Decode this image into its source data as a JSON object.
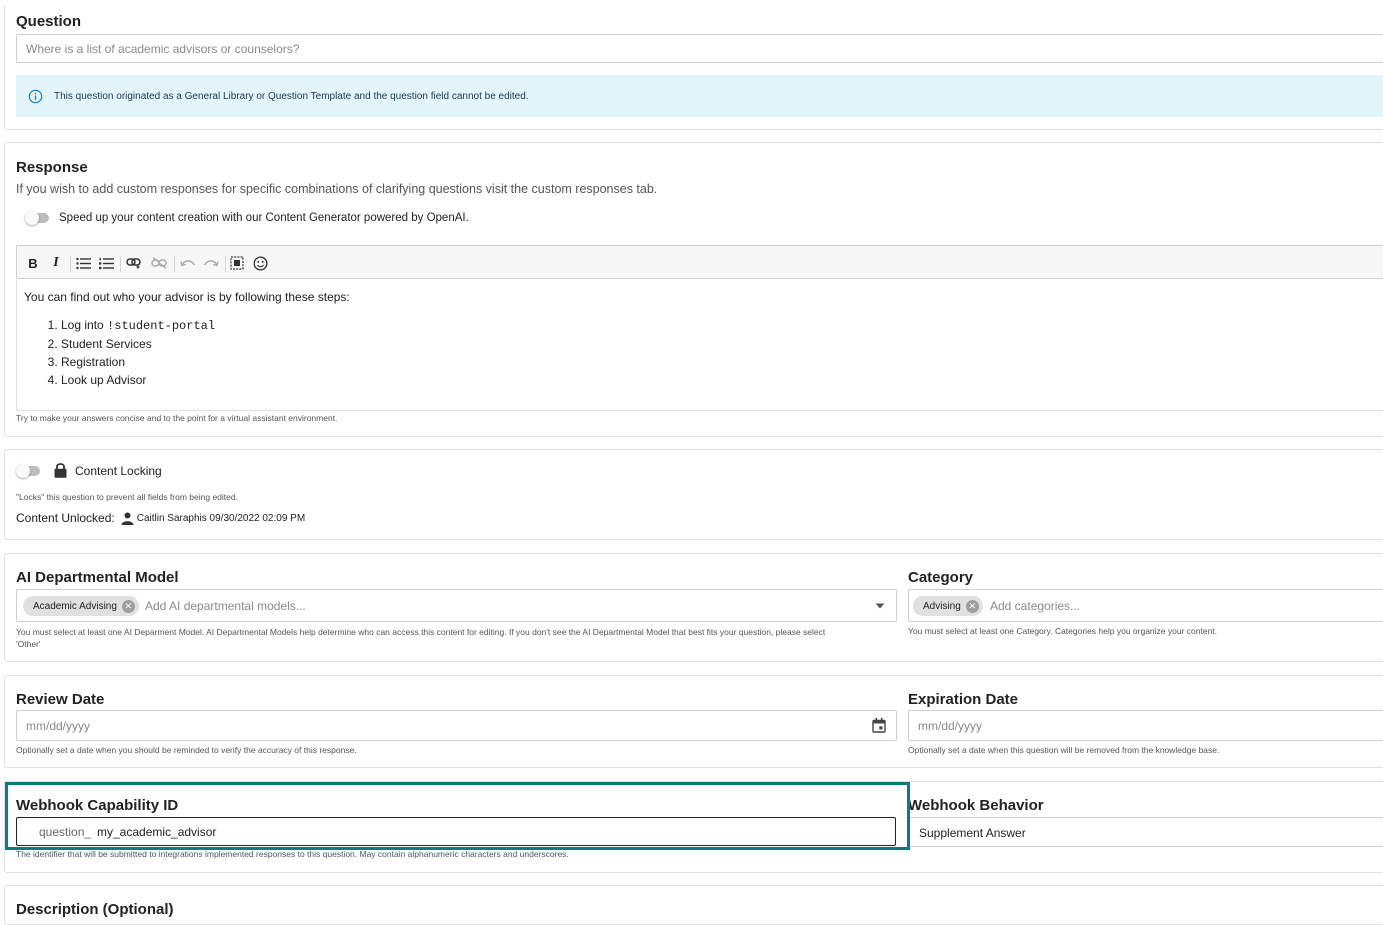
{
  "question": {
    "heading": "Question",
    "placeholder": "Where is a list of academic advisors or counselors?",
    "info_text": "This question originated as a General Library or Question Template and the question field cannot be edited."
  },
  "response": {
    "heading": "Response",
    "subtitle": "If you wish to add custom responses for specific combinations of clarifying questions visit the custom responses tab.",
    "generator_label": "Speed up your content creation with our Content Generator powered by OpenAI.",
    "toolbar": {
      "icons": [
        "bold-icon",
        "italic-icon",
        "bullet-list-icon",
        "numbered-list-icon",
        "insert-link-icon",
        "remove-link-icon",
        "undo-icon",
        "redo-icon",
        "select-all-icon",
        "emoji-icon"
      ],
      "bold_glyph": "B",
      "italic_glyph": "I"
    },
    "editor_intro": "You can find out who your advisor is by following these steps:",
    "steps": {
      "step1_prefix": "Log into ",
      "step1_code": "!student-portal",
      "step2": "Student Services",
      "step3": "Registration",
      "step4": "Look up Advisor"
    },
    "hint": "Try to make your answers concise and to the point for a virtual assistant environment."
  },
  "locking": {
    "label": "Content Locking",
    "description": "\"Locks\" this question to prevent all fields from being edited.",
    "status_label": "Content Unlocked:",
    "status_value": "Caitlin Saraphis 09/30/2022 02:09 PM"
  },
  "ai_model": {
    "heading": "AI Departmental Model",
    "chip": "Academic Advising",
    "placeholder": "Add AI departmental models...",
    "help_line1": "You must select at least one AI Deparment Model. AI Departmental Models help determine who can access this content for editing. If you don't see the AI Departmental Model that best fits your question, please select",
    "help_line2": "'Other'"
  },
  "category": {
    "heading": "Category",
    "chip": "Advising",
    "placeholder": "Add categories...",
    "help": "You must select at least one Category. Categories help you organize your content."
  },
  "review_date": {
    "heading": "Review Date",
    "placeholder": "mm/dd/yyyy",
    "help": "Optionally set a date when you should be reminded to verify the accuracy of this response."
  },
  "expiration_date": {
    "heading": "Expiration Date",
    "placeholder": "mm/dd/yyyy",
    "help": "Optionally set a date when this question will be removed from the knowledge base."
  },
  "webhook": {
    "heading": "Webhook Capability ID",
    "prefix": "question_",
    "value": "my_academic_advisor",
    "help": "The identifier that will be submitted to integrations implemented responses to this question. May contain alphanumeric characters and underscores.",
    "behavior_heading": "Webhook Behavior",
    "behavior_value": "Supplement Answer",
    "highlight_color": "#0a7c80"
  },
  "description": {
    "heading": "Description (Optional)"
  },
  "colors": {
    "info_bg": "#e3f4fb",
    "info_text": "#1a3a52",
    "info_icon": "#1a7fc1"
  }
}
